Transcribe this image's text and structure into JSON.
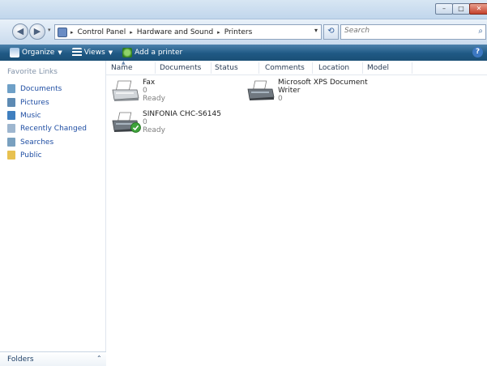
{
  "window": {
    "minimize_glyph": "–",
    "maximize_glyph": "□",
    "close_glyph": "✕"
  },
  "address_bar": {
    "breadcrumbs": [
      "Control Panel",
      "Hardware and Sound",
      "Printers"
    ],
    "separator": "▸",
    "dropdown_glyph": "▾",
    "refresh_glyph": "⟲"
  },
  "search": {
    "placeholder": "Search",
    "icon": "search-icon"
  },
  "toolbar": {
    "organize_label": "Organize",
    "views_label": "Views",
    "add_printer_label": "Add a printer",
    "help_glyph": "?"
  },
  "nav_pane": {
    "heading": "Favorite Links",
    "links": [
      {
        "label": "Documents",
        "icon": "documents-icon"
      },
      {
        "label": "Pictures",
        "icon": "pictures-icon"
      },
      {
        "label": "Music",
        "icon": "music-icon"
      },
      {
        "label": "Recently Changed",
        "icon": "recently-changed-icon"
      },
      {
        "label": "Searches",
        "icon": "searches-icon"
      },
      {
        "label": "Public",
        "icon": "public-folder-icon"
      }
    ],
    "folders_label": "Folders",
    "folders_chevron": "⌃"
  },
  "columns": [
    "Name",
    "Documents",
    "Status",
    "Comments",
    "Location",
    "Model"
  ],
  "printers": [
    {
      "name": "Fax",
      "documents": "0",
      "status": "Ready",
      "default": false
    },
    {
      "name": "Microsoft XPS Document",
      "name_line2": "Writer",
      "documents": "0",
      "status": "",
      "default": false
    },
    {
      "name": "SINFONIA CHC-S6145",
      "documents": "0",
      "status": "Ready",
      "default": true
    }
  ],
  "colors": {
    "toolbar_bg": "#1f5984",
    "link_blue": "#1f4ea3",
    "muted_text": "#7f7f7f"
  }
}
